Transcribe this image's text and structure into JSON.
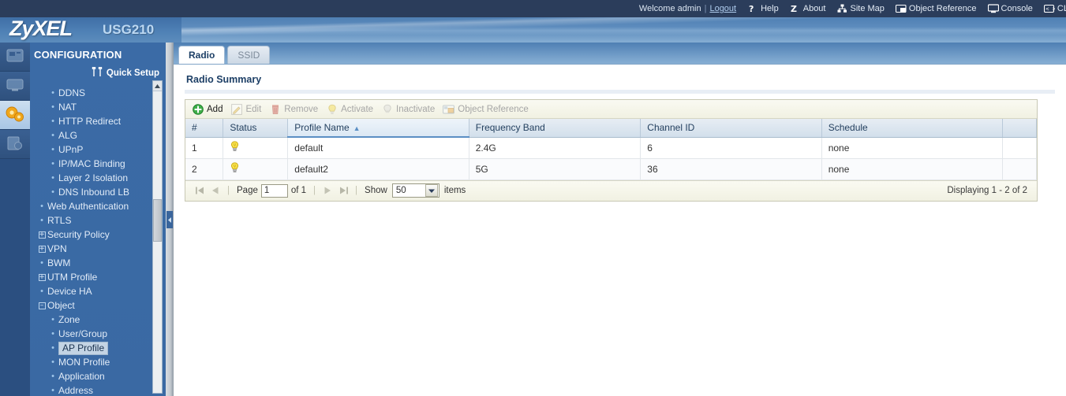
{
  "utility_bar": {
    "welcome": "Welcome admin",
    "separator": "|",
    "logout": "Logout",
    "items": [
      {
        "label": "Help",
        "icon": "help-icon"
      },
      {
        "label": "About",
        "icon": "about-icon"
      },
      {
        "label": "Site Map",
        "icon": "site-map-icon"
      },
      {
        "label": "Object Reference",
        "icon": "object-reference-icon"
      },
      {
        "label": "Console",
        "icon": "console-icon"
      },
      {
        "label": "CLI",
        "icon": "cli-icon"
      }
    ]
  },
  "brand": {
    "logo": "ZyXEL",
    "model": "USG210"
  },
  "icon_rail": [
    {
      "name": "dashboard-icon",
      "active": false
    },
    {
      "name": "monitor-icon",
      "active": false
    },
    {
      "name": "configuration-icon",
      "active": true
    },
    {
      "name": "maintenance-icon",
      "active": false
    }
  ],
  "sidebar": {
    "title": "CONFIGURATION",
    "quick_setup": "Quick Setup",
    "items": [
      {
        "label": "DDNS",
        "level": 2,
        "mark": "dot",
        "selected": false
      },
      {
        "label": "NAT",
        "level": 2,
        "mark": "dot",
        "selected": false
      },
      {
        "label": "HTTP Redirect",
        "level": 2,
        "mark": "dot",
        "selected": false
      },
      {
        "label": "ALG",
        "level": 2,
        "mark": "dot",
        "selected": false
      },
      {
        "label": "UPnP",
        "level": 2,
        "mark": "dot",
        "selected": false
      },
      {
        "label": "IP/MAC Binding",
        "level": 2,
        "mark": "dot",
        "selected": false
      },
      {
        "label": "Layer 2 Isolation",
        "level": 2,
        "mark": "dot",
        "selected": false
      },
      {
        "label": "DNS Inbound LB",
        "level": 2,
        "mark": "dot",
        "selected": false
      },
      {
        "label": "Web Authentication",
        "level": 1,
        "mark": "dot",
        "selected": false
      },
      {
        "label": "RTLS",
        "level": 1,
        "mark": "dot",
        "selected": false
      },
      {
        "label": "Security Policy",
        "level": 1,
        "mark": "plus",
        "selected": false
      },
      {
        "label": "VPN",
        "level": 1,
        "mark": "plus",
        "selected": false
      },
      {
        "label": "BWM",
        "level": 1,
        "mark": "dot",
        "selected": false
      },
      {
        "label": "UTM Profile",
        "level": 1,
        "mark": "plus",
        "selected": false
      },
      {
        "label": "Device HA",
        "level": 1,
        "mark": "dot",
        "selected": false
      },
      {
        "label": "Object",
        "level": 1,
        "mark": "minus",
        "selected": false
      },
      {
        "label": "Zone",
        "level": 2,
        "mark": "dot",
        "selected": false
      },
      {
        "label": "User/Group",
        "level": 2,
        "mark": "dot",
        "selected": false
      },
      {
        "label": "AP Profile",
        "level": 2,
        "mark": "dot",
        "selected": true
      },
      {
        "label": "MON Profile",
        "level": 2,
        "mark": "dot",
        "selected": false
      },
      {
        "label": "Application",
        "level": 2,
        "mark": "dot",
        "selected": false
      },
      {
        "label": "Address",
        "level": 2,
        "mark": "dot",
        "selected": false
      }
    ]
  },
  "tabs": [
    {
      "label": "Radio",
      "active": true
    },
    {
      "label": "SSID",
      "active": false
    }
  ],
  "panel": {
    "title": "Radio Summary"
  },
  "toolbar": [
    {
      "label": "Add",
      "icon": "add-icon",
      "enabled": true
    },
    {
      "label": "Edit",
      "icon": "edit-icon",
      "enabled": false
    },
    {
      "label": "Remove",
      "icon": "remove-icon",
      "enabled": false
    },
    {
      "label": "Activate",
      "icon": "activate-icon",
      "enabled": false
    },
    {
      "label": "Inactivate",
      "icon": "inactivate-icon",
      "enabled": false
    },
    {
      "label": "Object Reference",
      "icon": "object-reference-icon",
      "enabled": false
    }
  ],
  "table": {
    "columns": [
      {
        "label": "#",
        "key": "num",
        "sorted": false
      },
      {
        "label": "Status",
        "key": "status",
        "sorted": false
      },
      {
        "label": "Profile Name",
        "key": "profile",
        "sorted": true,
        "sort_dir": "asc"
      },
      {
        "label": "Frequency Band",
        "key": "freq",
        "sorted": false
      },
      {
        "label": "Channel ID",
        "key": "chan",
        "sorted": false
      },
      {
        "label": "Schedule",
        "key": "sched",
        "sorted": false
      }
    ],
    "rows": [
      {
        "num": "1",
        "status": "active",
        "profile": "default",
        "freq": "2.4G",
        "chan": "6",
        "sched": "none"
      },
      {
        "num": "2",
        "status": "active",
        "profile": "default2",
        "freq": "5G",
        "chan": "36",
        "sched": "none"
      }
    ]
  },
  "pagination": {
    "page_label": "Page",
    "page_value": "1",
    "of_label": "of 1",
    "show_label": "Show",
    "show_value": "50",
    "items_label": "items",
    "displaying": "Displaying 1 - 2 of 2"
  },
  "colors": {
    "brand_blue": "#4f7fb3",
    "utility_navy": "#2b3d5b",
    "sidebar_blue": "#3b6ba6",
    "accent": "#5b8fc4",
    "toolbar_cream": "#f1f1e2",
    "status_bulb": "#f5d93a"
  }
}
